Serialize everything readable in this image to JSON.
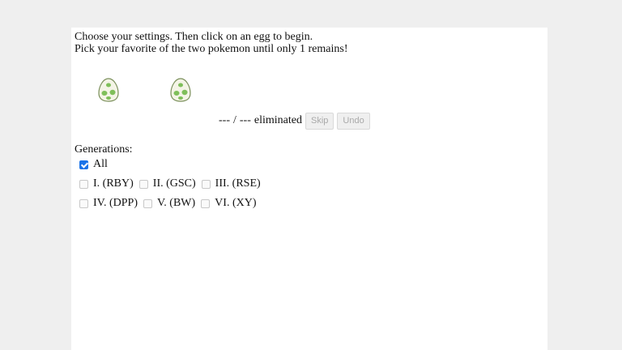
{
  "intro": {
    "line1": "Choose your settings. Then click on an egg to begin.",
    "line2": "Pick your favorite of the two pokemon until only 1 remains!"
  },
  "status": {
    "remaining": "---",
    "separator": "/",
    "total": "---",
    "eliminated_label": "eliminated"
  },
  "buttons": {
    "skip_label": "Skip",
    "undo_label": "Undo"
  },
  "generations": {
    "title": "Generations:",
    "all_label": "All",
    "all_checked": true,
    "items": [
      {
        "label": "I. (RBY)",
        "checked": false
      },
      {
        "label": "II. (GSC)",
        "checked": false
      },
      {
        "label": "III. (RSE)",
        "checked": false
      },
      {
        "label": "IV. (DPP)",
        "checked": false
      },
      {
        "label": "V. (BW)",
        "checked": false
      },
      {
        "label": "VI. (XY)",
        "checked": false
      }
    ]
  },
  "colors": {
    "page_bg": "#efefef",
    "panel_bg": "#ffffff",
    "checkbox_accent": "#1a73e8",
    "egg_shell": "#f4f4e6",
    "egg_spots": "#7fbf5a"
  },
  "icons": {
    "egg_left": "egg-icon",
    "egg_right": "egg-icon"
  }
}
